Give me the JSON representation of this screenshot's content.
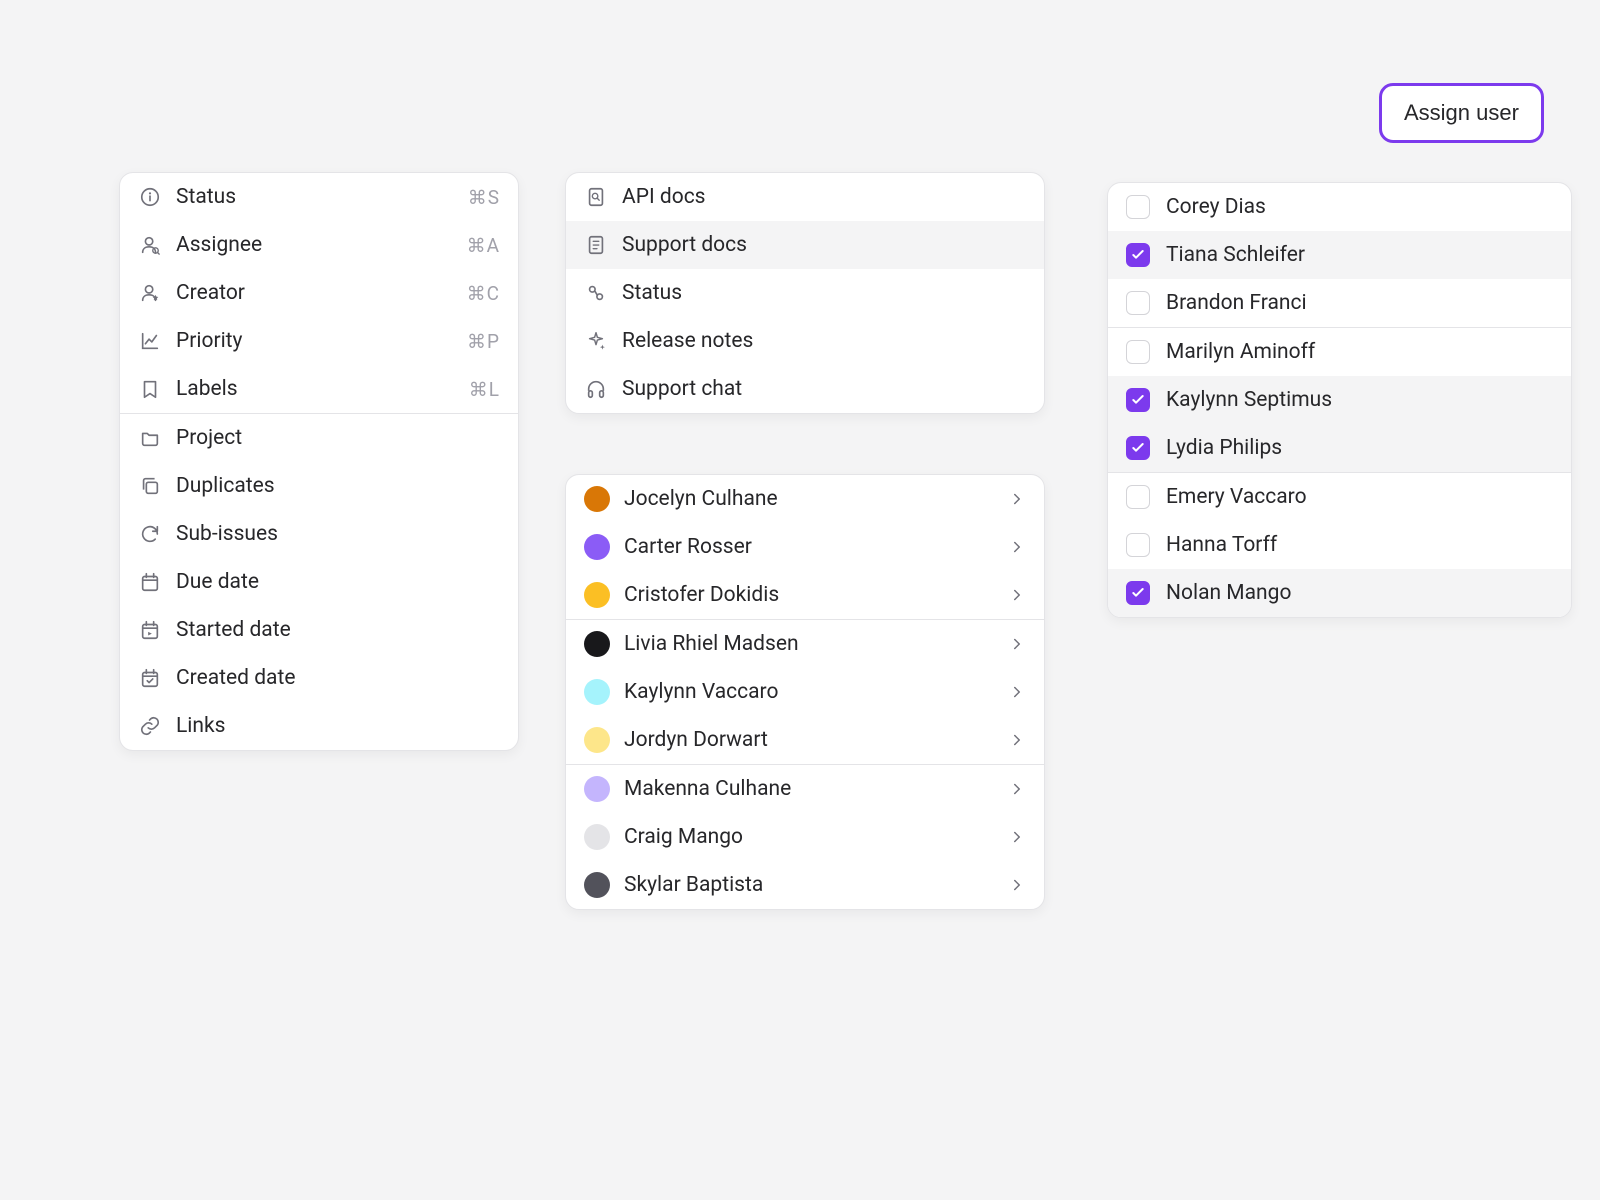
{
  "assign_button": "Assign user",
  "panel1": {
    "section1": [
      {
        "icon": "info",
        "label": "Status",
        "shortcut": "⌘S"
      },
      {
        "icon": "assignee",
        "label": "Assignee",
        "shortcut": "⌘A"
      },
      {
        "icon": "creator",
        "label": "Creator",
        "shortcut": "⌘C"
      },
      {
        "icon": "chart",
        "label": "Priority",
        "shortcut": "⌘P"
      },
      {
        "icon": "bookmark",
        "label": "Labels",
        "shortcut": "⌘L"
      }
    ],
    "section2": [
      {
        "icon": "folder",
        "label": "Project"
      },
      {
        "icon": "copy",
        "label": "Duplicates"
      },
      {
        "icon": "refresh",
        "label": "Sub-issues"
      },
      {
        "icon": "calendar",
        "label": "Due date"
      },
      {
        "icon": "calendar-start",
        "label": "Started date"
      },
      {
        "icon": "calendar-check",
        "label": "Created date"
      },
      {
        "icon": "link",
        "label": "Links"
      }
    ]
  },
  "panel2": [
    {
      "icon": "doc-search",
      "label": "API docs"
    },
    {
      "icon": "doc",
      "label": "Support docs",
      "hover": true
    },
    {
      "icon": "status",
      "label": "Status"
    },
    {
      "icon": "sparkle",
      "label": "Release notes"
    },
    {
      "icon": "headphones",
      "label": "Support chat"
    }
  ],
  "panel3": {
    "groups": [
      [
        {
          "name": "Jocelyn Culhane",
          "color": "#d97706"
        },
        {
          "name": "Carter Rosser",
          "color": "#8b5cf6"
        },
        {
          "name": "Cristofer Dokidis",
          "color": "#fbbf24"
        }
      ],
      [
        {
          "name": "Livia Rhiel Madsen",
          "color": "#18181b"
        },
        {
          "name": "Kaylynn Vaccaro",
          "color": "#a5f3fc"
        },
        {
          "name": "Jordyn Dorwart",
          "color": "#fde68a"
        }
      ],
      [
        {
          "name": "Makenna Culhane",
          "color": "#c4b5fd"
        },
        {
          "name": "Craig Mango",
          "color": "#e4e4e7"
        },
        {
          "name": "Skylar Baptista",
          "color": "#52525b"
        }
      ]
    ]
  },
  "panel4": {
    "groups": [
      [
        {
          "name": "Corey Dias",
          "checked": false
        },
        {
          "name": "Tiana Schleifer",
          "checked": true
        },
        {
          "name": "Brandon Franci",
          "checked": false
        }
      ],
      [
        {
          "name": "Marilyn Aminoff",
          "checked": false
        },
        {
          "name": "Kaylynn Septimus",
          "checked": true
        },
        {
          "name": "Lydia Philips",
          "checked": true
        }
      ],
      [
        {
          "name": "Emery Vaccaro",
          "checked": false
        },
        {
          "name": "Hanna Torff",
          "checked": false
        },
        {
          "name": "Nolan Mango",
          "checked": true
        }
      ]
    ]
  },
  "colors": {
    "accent": "#7c3aed"
  }
}
